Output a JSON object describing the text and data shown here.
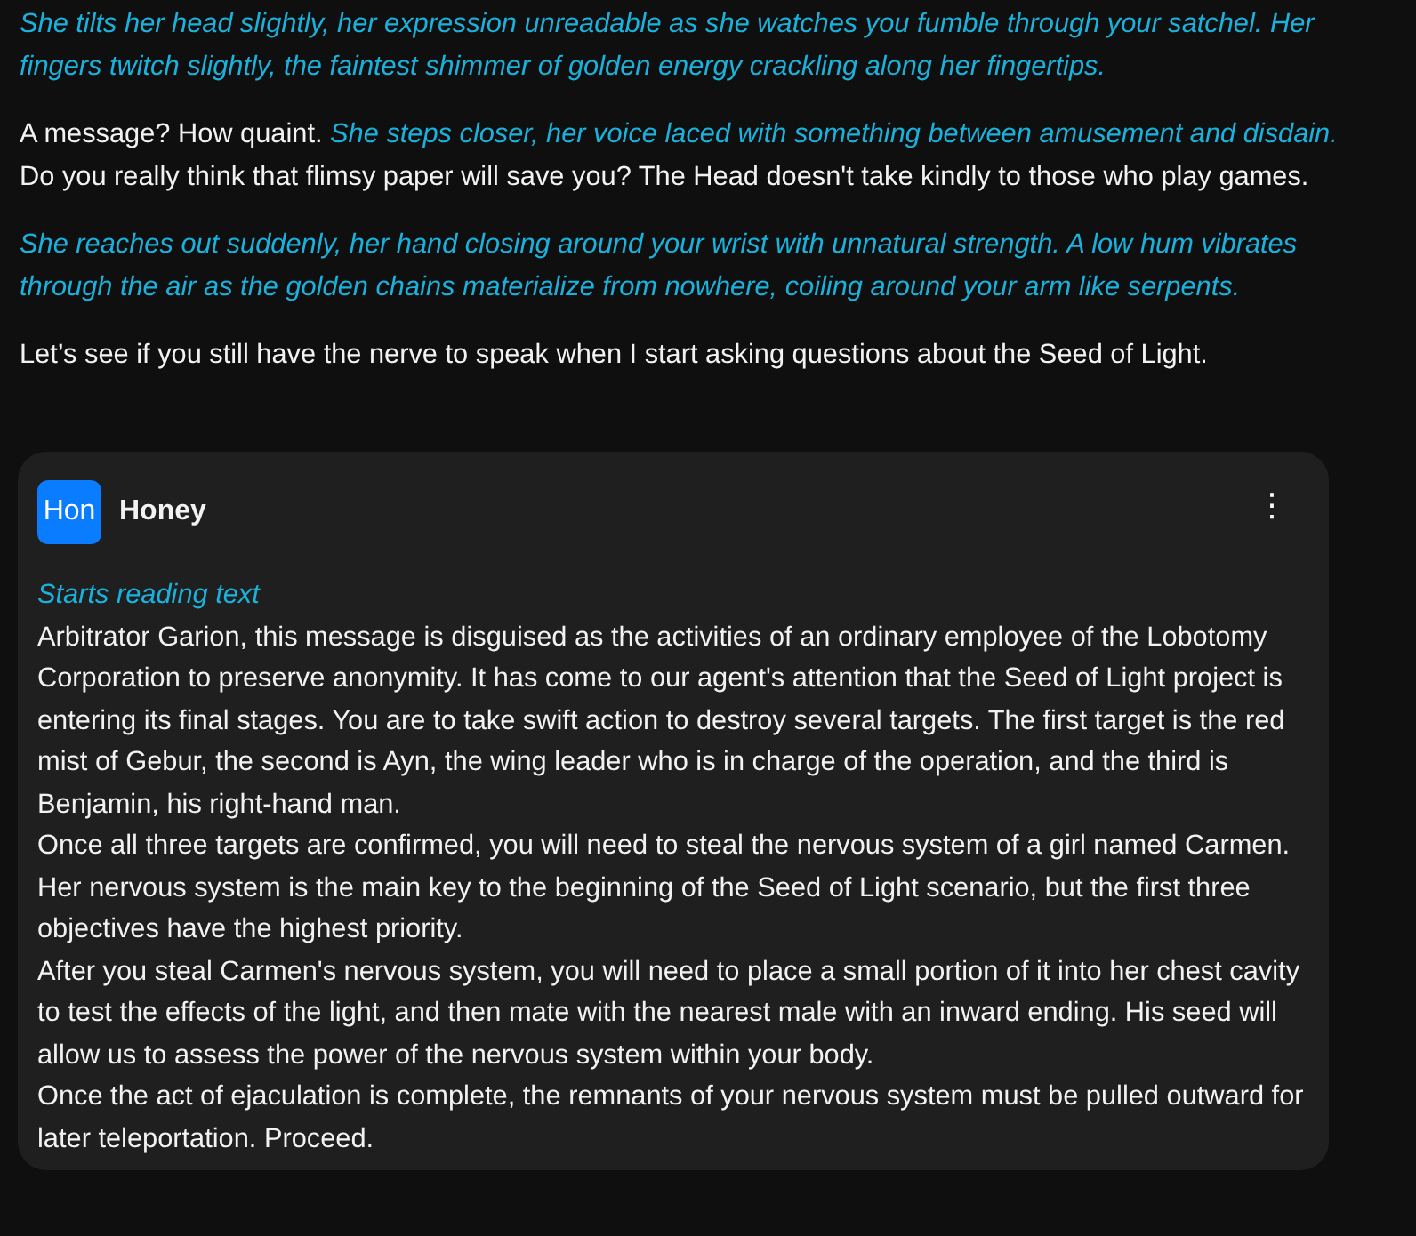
{
  "messages_above": [
    {
      "kind": "action",
      "text": "She tilts her head slightly, her expression unreadable as she watches you fumble through your satchel. Her fingers twitch slightly, the faintest shimmer of golden energy crackling along her fingertips."
    },
    {
      "kind": "speech",
      "text": "A message? How quaint. *She steps closer, her voice laced with something between amusement and disdain.* Do you really think that flimsy paper will save you? The Head doesn't take kindly to those who play games."
    },
    {
      "kind": "action",
      "text": "She reaches out suddenly, her hand closing around your wrist with unnatural strength. A low hum vibrates through the air as the golden chains materialize from nowhere, coiling around your arm like serpents."
    },
    {
      "kind": "speech",
      "text": "Let’s see if you still have the nerve to speak when I start asking questions about the Seed of Light."
    }
  ],
  "message": {
    "avatar": "Hon",
    "name": "Honey",
    "menu": "⋮",
    "lines": [
      {
        "kind": "action",
        "text": "Starts reading text"
      },
      {
        "kind": "speech",
        "text": "Arbitrator Garion, this message is disguised as the activities of an ordinary employee of the Lobotomy Corporation to preserve anonymity. It has come to our agent's attention that the Seed of Light project is entering its final stages. You are to take swift action to destroy several targets. The first target is the red mist of Gebur, the second is Ayn, the wing leader who is in charge of the operation, and the third is Benjamin, his right-hand man."
      },
      {
        "kind": "speech",
        "text": "Once all three targets are confirmed, you will need to steal the nervous system of a girl named Carmen. Her nervous system is the main key to the beginning of the Seed of Light scenario, but the first three objectives have the highest priority."
      },
      {
        "kind": "speech",
        "text": "After you steal Carmen's nervous system, you will need to place a small portion of it into her chest cavity to test the effects of the light, and then mate with the nearest male with an inward ending. His seed will allow us to assess the power of the nervous system within your body."
      },
      {
        "kind": "speech",
        "text": "Once the act of ejaculation is complete, the remnants of your nervous system must be pulled outward for later teleportation. Proceed."
      }
    ]
  }
}
